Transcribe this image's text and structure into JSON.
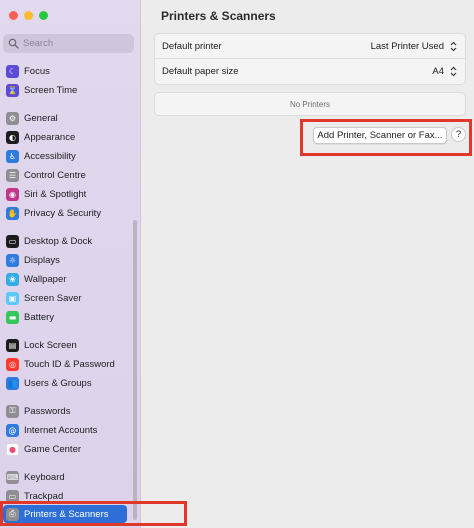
{
  "window": {
    "traffic_colors": {
      "close": "#ff5f57",
      "minimize": "#febc2e",
      "zoom": "#28c840"
    }
  },
  "sidebar": {
    "search_placeholder": "Search",
    "items": [
      {
        "id": "focus",
        "label": "Focus",
        "icon": "moon-icon",
        "color": "#5b4bd6",
        "glyph": "☾"
      },
      {
        "id": "screen-time",
        "label": "Screen Time",
        "icon": "hourglass-icon",
        "color": "#5b4bd6",
        "glyph": "⌛"
      },
      {
        "id": "general",
        "label": "General",
        "icon": "gear-icon",
        "color": "#8e8e93",
        "glyph": "⚙"
      },
      {
        "id": "appearance",
        "label": "Appearance",
        "icon": "appearance-icon",
        "color": "#1c1c1e",
        "glyph": "◐"
      },
      {
        "id": "accessibility",
        "label": "Accessibility",
        "icon": "accessibility-icon",
        "color": "#2f7ce0",
        "glyph": "♿"
      },
      {
        "id": "control-centre",
        "label": "Control Centre",
        "icon": "control-centre-icon",
        "color": "#8e8e93",
        "glyph": "☰"
      },
      {
        "id": "siri-spotlight",
        "label": "Siri & Spotlight",
        "icon": "siri-icon",
        "color": "#c2358a",
        "glyph": "◉"
      },
      {
        "id": "privacy-security",
        "label": "Privacy & Security",
        "icon": "hand-icon",
        "color": "#2f7ce0",
        "glyph": "✋"
      },
      {
        "id": "desktop-dock",
        "label": "Desktop & Dock",
        "icon": "dock-icon",
        "color": "#1c1c1e",
        "glyph": "▭"
      },
      {
        "id": "displays",
        "label": "Displays",
        "icon": "displays-icon",
        "color": "#2f7ce0",
        "glyph": "☼"
      },
      {
        "id": "wallpaper",
        "label": "Wallpaper",
        "icon": "flower-icon",
        "color": "#32ade6",
        "glyph": "❀"
      },
      {
        "id": "screen-saver",
        "label": "Screen Saver",
        "icon": "screen-saver-icon",
        "color": "#5ac8fa",
        "glyph": "▣"
      },
      {
        "id": "battery",
        "label": "Battery",
        "icon": "battery-icon",
        "color": "#34c759",
        "glyph": "▬"
      },
      {
        "id": "lock-screen",
        "label": "Lock Screen",
        "icon": "lock-icon",
        "color": "#1c1c1e",
        "glyph": "▤"
      },
      {
        "id": "touch-id",
        "label": "Touch ID & Password",
        "icon": "fingerprint-icon",
        "color": "#ff3b30",
        "glyph": "◎"
      },
      {
        "id": "users-groups",
        "label": "Users & Groups",
        "icon": "users-icon",
        "color": "#2f7ce0",
        "glyph": "👥"
      },
      {
        "id": "passwords",
        "label": "Passwords",
        "icon": "key-icon",
        "color": "#8e8e93",
        "glyph": "⚿"
      },
      {
        "id": "internet-accounts",
        "label": "Internet Accounts",
        "icon": "at-icon",
        "color": "#2f7ce0",
        "glyph": "@"
      },
      {
        "id": "game-center",
        "label": "Game Center",
        "icon": "game-center-icon",
        "color": "#ffffff",
        "glyph": "●"
      },
      {
        "id": "keyboard",
        "label": "Keyboard",
        "icon": "keyboard-icon",
        "color": "#8e8e93",
        "glyph": "⌨"
      },
      {
        "id": "trackpad",
        "label": "Trackpad",
        "icon": "trackpad-icon",
        "color": "#8e8e93",
        "glyph": "▭"
      },
      {
        "id": "printers-scanners",
        "label": "Printers & Scanners",
        "icon": "printer-icon",
        "color": "#8e8e93",
        "glyph": "⎙",
        "selected": true
      }
    ]
  },
  "main": {
    "title": "Printers & Scanners",
    "settings": [
      {
        "label": "Default printer",
        "value": "Last Printer Used"
      },
      {
        "label": "Default paper size",
        "value": "A4"
      }
    ],
    "printers_empty": "No Printers",
    "add_button": "Add Printer, Scanner or Fax...",
    "help_button": "?"
  },
  "colors": {
    "accent": "#2d6fd6",
    "highlight": "#e0382b"
  }
}
